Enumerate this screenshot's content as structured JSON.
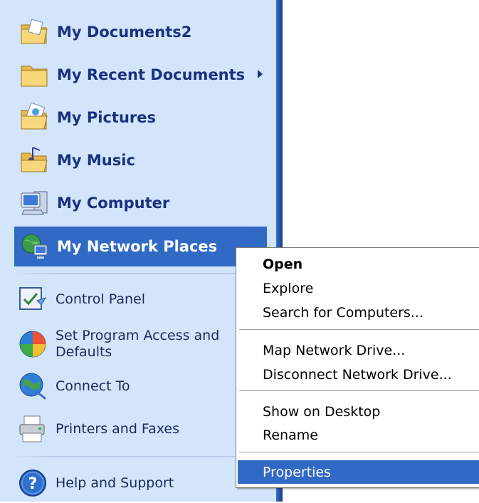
{
  "start_menu": {
    "places": [
      {
        "label": "My Documents2",
        "icon": "my-documents-icon"
      },
      {
        "label": "My Recent Documents",
        "icon": "folder-icon",
        "has_submenu": true
      },
      {
        "label": "My Pictures",
        "icon": "my-pictures-icon"
      },
      {
        "label": "My Music",
        "icon": "my-music-icon"
      },
      {
        "label": "My Computer",
        "icon": "my-computer-icon"
      },
      {
        "label": "My Network Places",
        "icon": "network-places-icon",
        "selected": true
      }
    ],
    "system": [
      {
        "label": "Control Panel",
        "icon": "control-panel-icon"
      },
      {
        "label": "Set Program Access and\nDefaults",
        "icon": "program-access-icon"
      },
      {
        "label": "Connect To",
        "icon": "connect-to-icon"
      },
      {
        "label": "Printers and Faxes",
        "icon": "printer-icon"
      },
      {
        "label": "Help and Support",
        "icon": "help-icon"
      }
    ]
  },
  "context_menu": {
    "items": [
      {
        "label": "Open",
        "bold": true
      },
      {
        "label": "Explore"
      },
      {
        "label": "Search for Computers..."
      },
      {
        "label": "Map Network Drive..."
      },
      {
        "label": "Disconnect Network Drive..."
      },
      {
        "label": "Show on Desktop"
      },
      {
        "label": "Rename"
      },
      {
        "label": "Properties",
        "selected": true
      }
    ]
  },
  "colors": {
    "pane_bg": "#d3e5fa",
    "highlight": "#316ac5",
    "label_blue": "#1a3080"
  }
}
